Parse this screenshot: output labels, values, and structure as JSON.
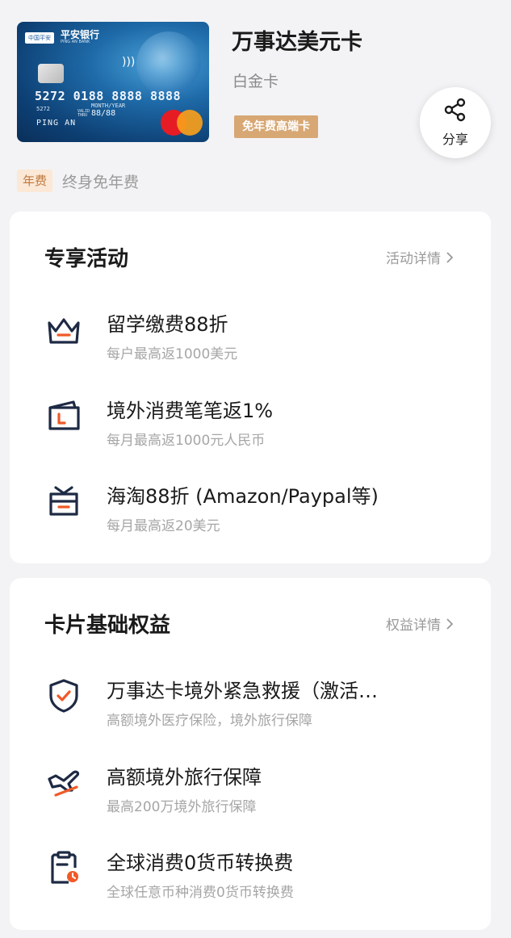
{
  "card": {
    "bank_name": "平安银行",
    "bank_name_en": "PING AN BANK",
    "bank_logo_text": "中国平安",
    "number": "5272 0188 8888 8888",
    "bin": "5272",
    "month_year_label": "MONTH/YEAR",
    "valid_thru_label": "VALID THRU",
    "expiry": "88/88",
    "holder": "PING AN",
    "title": "万事达美元卡",
    "tier": "白金卡",
    "badge": "免年费高端卡"
  },
  "share": {
    "label": "分享"
  },
  "fee": {
    "tag": "年费",
    "value": "终身免年费"
  },
  "activities": {
    "title": "专享活动",
    "detail_link": "活动详情",
    "items": [
      {
        "icon": "basket-icon",
        "title": "留学缴费88折",
        "desc": "每户最高返1000美元"
      },
      {
        "icon": "wallet-icon",
        "title": "境外消费笔笔返1%",
        "desc": "每月最高返1000元人民币"
      },
      {
        "icon": "shopping-box-icon",
        "title": "海淘88折 (Amazon/Paypal等)",
        "desc": "每月最高返20美元"
      }
    ]
  },
  "benefits": {
    "title": "卡片基础权益",
    "detail_link": "权益详情",
    "items": [
      {
        "icon": "shield-check-icon",
        "title": "万事达卡境外紧急救援（激活…",
        "desc": "高额境外医疗保险，境外旅行保障"
      },
      {
        "icon": "airplane-icon",
        "title": "高额境外旅行保障",
        "desc": "最高200万境外旅行保障"
      },
      {
        "icon": "clipboard-clock-icon",
        "title": "全球消费0货币转换费",
        "desc": "全球任意币种消费0货币转换费"
      }
    ]
  },
  "colors": {
    "icon_dark": "#1e2a44",
    "icon_accent": "#f05a28",
    "badge_bg": "#d7a774",
    "fee_tag_bg": "#fbe8d6",
    "fee_tag_text": "#c0783d"
  }
}
